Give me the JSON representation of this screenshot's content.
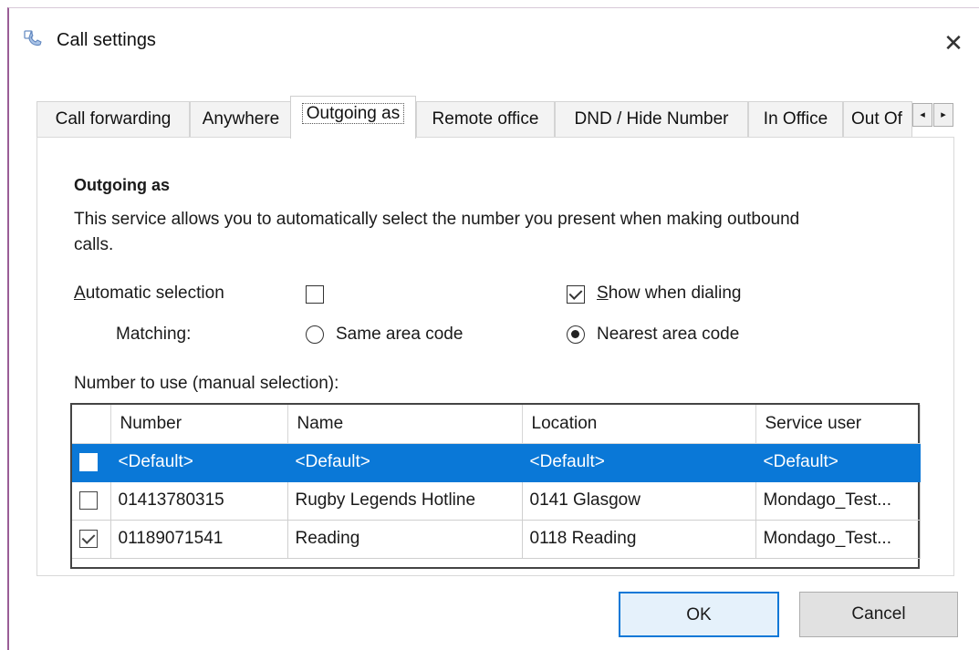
{
  "window": {
    "title": "Call settings",
    "icon": "phone-settings-icon",
    "close_glyph": "✕"
  },
  "tabs": [
    {
      "label": "Call forwarding",
      "active": false
    },
    {
      "label": "Anywhere",
      "active": false
    },
    {
      "label": "Outgoing as",
      "active": true
    },
    {
      "label": "Remote office",
      "active": false
    },
    {
      "label": "DND / Hide Number",
      "active": false
    },
    {
      "label": "In Office",
      "active": false
    },
    {
      "label": "Out Of",
      "active": false
    }
  ],
  "tab_scroll": {
    "left_glyph": "◂",
    "right_glyph": "▸"
  },
  "section": {
    "title": "Outgoing as",
    "description": "This service allows you to automatically select the number you present when making outbound calls."
  },
  "options": {
    "automatic_selection_label_underlined": "A",
    "automatic_selection_label_rest": "utomatic selection",
    "automatic_selection_checked": false,
    "show_when_dialing_label_underlined": "S",
    "show_when_dialing_label_rest": "how when dialing",
    "show_when_dialing_checked": true,
    "matching_label": "Matching:",
    "same_area_code_label": "Same area code",
    "same_area_code_selected": false,
    "nearest_area_code_label": "Nearest area code",
    "nearest_area_code_selected": true
  },
  "numbers": {
    "label": "Number to use (manual selection):",
    "columns": [
      "Number",
      "Name",
      "Location",
      "Service user"
    ],
    "rows": [
      {
        "checked": false,
        "selected": true,
        "number": "<Default>",
        "name": "<Default>",
        "location": "<Default>",
        "service_user": "<Default>"
      },
      {
        "checked": false,
        "selected": false,
        "number": "01413780315",
        "name": "Rugby Legends Hotline",
        "location": "0141 Glasgow",
        "service_user": "Mondago_Test..."
      },
      {
        "checked": true,
        "selected": false,
        "number": "01189071541",
        "name": "Reading",
        "location": "0118 Reading",
        "service_user": "Mondago_Test..."
      }
    ]
  },
  "buttons": {
    "ok": "OK",
    "cancel": "Cancel"
  },
  "colors": {
    "selection": "#0a78d7",
    "window_border": "#9a5e96"
  }
}
